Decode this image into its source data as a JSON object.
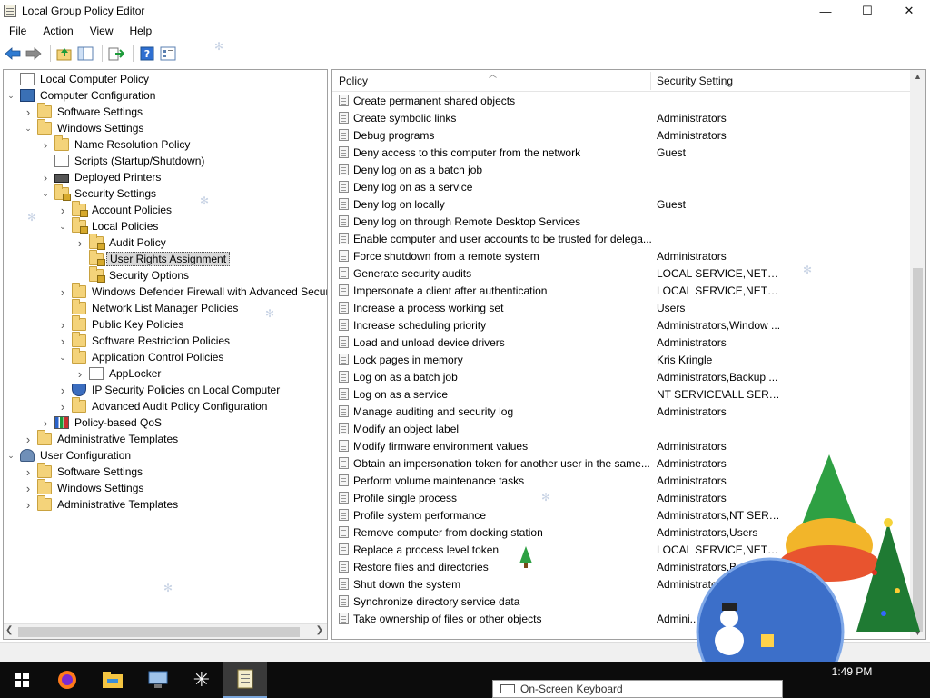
{
  "window": {
    "title": "Local Group Policy Editor",
    "controls": {
      "minimize": "—",
      "maximize": "☐",
      "close": "✕"
    }
  },
  "menu": [
    "File",
    "Action",
    "View",
    "Help"
  ],
  "toolbar_icons": [
    "back-arrow-icon",
    "forward-arrow-icon",
    "up-folder-icon",
    "show-hide-tree-icon",
    "export-list-icon",
    "help-icon",
    "properties-icon"
  ],
  "tree": [
    {
      "label": "Local Computer Policy",
      "icon": "doc",
      "depth": 0,
      "twisty": ""
    },
    {
      "label": "Computer Configuration",
      "icon": "pc",
      "depth": 0,
      "twisty": "open"
    },
    {
      "label": "Software Settings",
      "icon": "folder",
      "depth": 1,
      "twisty": "closed"
    },
    {
      "label": "Windows Settings",
      "icon": "folder",
      "depth": 1,
      "twisty": "open"
    },
    {
      "label": "Name Resolution Policy",
      "icon": "folder",
      "depth": 2,
      "twisty": "closed"
    },
    {
      "label": "Scripts (Startup/Shutdown)",
      "icon": "doc",
      "depth": 2,
      "twisty": ""
    },
    {
      "label": "Deployed Printers",
      "icon": "printer",
      "depth": 2,
      "twisty": "closed"
    },
    {
      "label": "Security Settings",
      "icon": "folder locked",
      "depth": 2,
      "twisty": "open"
    },
    {
      "label": "Account Policies",
      "icon": "folder locked",
      "depth": 3,
      "twisty": "closed"
    },
    {
      "label": "Local Policies",
      "icon": "folder locked",
      "depth": 3,
      "twisty": "open"
    },
    {
      "label": "Audit Policy",
      "icon": "folder locked",
      "depth": 4,
      "twisty": "closed"
    },
    {
      "label": "User Rights Assignment",
      "icon": "folder locked",
      "depth": 4,
      "twisty": "",
      "selected": true
    },
    {
      "label": "Security Options",
      "icon": "folder locked",
      "depth": 4,
      "twisty": ""
    },
    {
      "label": "Windows Defender Firewall with Advanced Secur",
      "icon": "folder",
      "depth": 3,
      "twisty": "closed"
    },
    {
      "label": "Network List Manager Policies",
      "icon": "folder",
      "depth": 3,
      "twisty": ""
    },
    {
      "label": "Public Key Policies",
      "icon": "folder",
      "depth": 3,
      "twisty": "closed"
    },
    {
      "label": "Software Restriction Policies",
      "icon": "folder",
      "depth": 3,
      "twisty": "closed"
    },
    {
      "label": "Application Control Policies",
      "icon": "folder",
      "depth": 3,
      "twisty": "open"
    },
    {
      "label": "AppLocker",
      "icon": "doc",
      "depth": 4,
      "twisty": "closed"
    },
    {
      "label": "IP Security Policies on Local Computer",
      "icon": "shield",
      "depth": 3,
      "twisty": "closed"
    },
    {
      "label": "Advanced Audit Policy Configuration",
      "icon": "folder",
      "depth": 3,
      "twisty": "closed"
    },
    {
      "label": "Policy-based QoS",
      "icon": "chart",
      "depth": 2,
      "twisty": "closed"
    },
    {
      "label": "Administrative Templates",
      "icon": "folder",
      "depth": 1,
      "twisty": "closed"
    },
    {
      "label": "User Configuration",
      "icon": "user",
      "depth": 0,
      "twisty": "open"
    },
    {
      "label": "Software Settings",
      "icon": "folder",
      "depth": 1,
      "twisty": "closed"
    },
    {
      "label": "Windows Settings",
      "icon": "folder",
      "depth": 1,
      "twisty": "closed"
    },
    {
      "label": "Administrative Templates",
      "icon": "folder",
      "depth": 1,
      "twisty": "closed"
    }
  ],
  "list": {
    "columns": {
      "policy": "Policy",
      "setting": "Security Setting"
    },
    "rows": [
      {
        "policy": "Create permanent shared objects",
        "setting": ""
      },
      {
        "policy": "Create symbolic links",
        "setting": "Administrators"
      },
      {
        "policy": "Debug programs",
        "setting": "Administrators"
      },
      {
        "policy": "Deny access to this computer from the network",
        "setting": "Guest"
      },
      {
        "policy": "Deny log on as a batch job",
        "setting": ""
      },
      {
        "policy": "Deny log on as a service",
        "setting": ""
      },
      {
        "policy": "Deny log on locally",
        "setting": "Guest"
      },
      {
        "policy": "Deny log on through Remote Desktop Services",
        "setting": ""
      },
      {
        "policy": "Enable computer and user accounts to be trusted for delega...",
        "setting": ""
      },
      {
        "policy": "Force shutdown from a remote system",
        "setting": "Administrators"
      },
      {
        "policy": "Generate security audits",
        "setting": "LOCAL SERVICE,NETWO..."
      },
      {
        "policy": "Impersonate a client after authentication",
        "setting": "LOCAL SERVICE,NETWO..."
      },
      {
        "policy": "Increase a process working set",
        "setting": "Users"
      },
      {
        "policy": "Increase scheduling priority",
        "setting": "Administrators,Window ..."
      },
      {
        "policy": "Load and unload device drivers",
        "setting": "Administrators"
      },
      {
        "policy": "Lock pages in memory",
        "setting": "Kris Kringle"
      },
      {
        "policy": "Log on as a batch job",
        "setting": "Administrators,Backup ..."
      },
      {
        "policy": "Log on as a service",
        "setting": "NT SERVICE\\ALL SERVIC..."
      },
      {
        "policy": "Manage auditing and security log",
        "setting": "Administrators"
      },
      {
        "policy": "Modify an object label",
        "setting": ""
      },
      {
        "policy": "Modify firmware environment values",
        "setting": "Administrators"
      },
      {
        "policy": "Obtain an impersonation token for another user in the same...",
        "setting": "Administrators"
      },
      {
        "policy": "Perform volume maintenance tasks",
        "setting": "Administrators"
      },
      {
        "policy": "Profile single process",
        "setting": "Administrators"
      },
      {
        "policy": "Profile system performance",
        "setting": "Administrators,NT SERVI..."
      },
      {
        "policy": "Remove computer from docking station",
        "setting": "Administrators,Users"
      },
      {
        "policy": "Replace a process level token",
        "setting": "LOCAL SERVICE,NETWO..."
      },
      {
        "policy": "Restore files and directories",
        "setting": "Administrators,Backu..."
      },
      {
        "policy": "Shut down the system",
        "setting": "Administrato..."
      },
      {
        "policy": "Synchronize directory service data",
        "setting": ""
      },
      {
        "policy": "Take ownership of files or other objects",
        "setting": "Admini..."
      }
    ]
  },
  "taskbar": {
    "apps": [
      "windows-start-icon",
      "firefox-icon",
      "file-explorer-icon",
      "computer-management-icon",
      "snowflake-app-icon",
      "group-policy-editor-icon"
    ],
    "clock": "1:49 PM",
    "osk_label": "On-Screen Keyboard"
  },
  "colors": {
    "taskbar": "#0c0c0c",
    "selection": "#d9d9d9",
    "folder": "#f4d37a"
  }
}
